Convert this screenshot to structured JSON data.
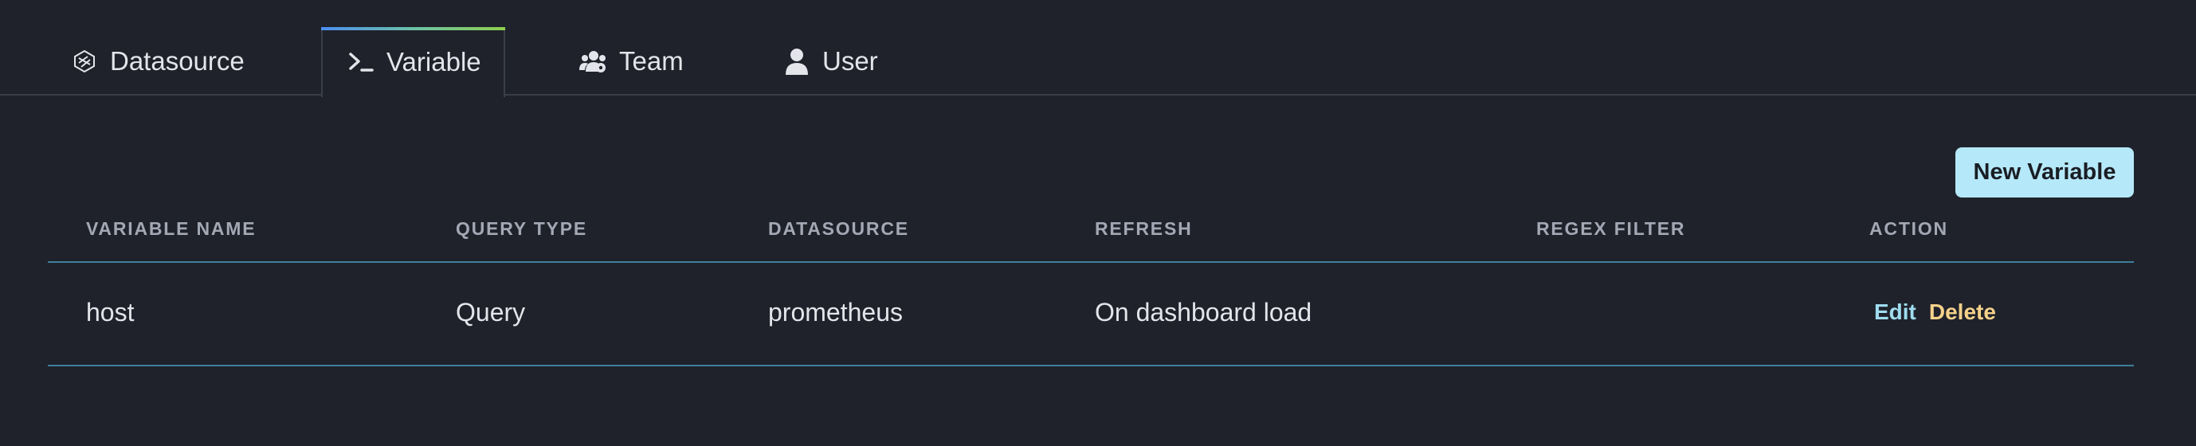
{
  "tabs": [
    {
      "label": "Datasource",
      "icon": "datasource-icon",
      "active": false
    },
    {
      "label": "Variable",
      "icon": "terminal-icon",
      "active": true
    },
    {
      "label": "Team",
      "icon": "team-icon",
      "active": false
    },
    {
      "label": "User",
      "icon": "user-icon",
      "active": false
    }
  ],
  "toolbar": {
    "new_variable_label": "New Variable"
  },
  "table": {
    "columns": [
      "Variable Name",
      "Query Type",
      "Datasource",
      "Refresh",
      "Regex Filter",
      "Action"
    ],
    "rows": [
      {
        "name": "host",
        "query_type": "Query",
        "datasource": "prometheus",
        "refresh": "On dashboard load",
        "regex_filter": "",
        "actions": {
          "edit": "Edit",
          "delete": "Delete"
        }
      }
    ]
  },
  "colors": {
    "background": "#1f222b",
    "active_tab_gradient": [
      "#4b8ef0",
      "#8ecf4c"
    ],
    "primary_button": "#b5e8f8",
    "edit_link": "#9fdcef",
    "delete_link": "#f5d28a",
    "row_divider": "#3f7f9c"
  }
}
